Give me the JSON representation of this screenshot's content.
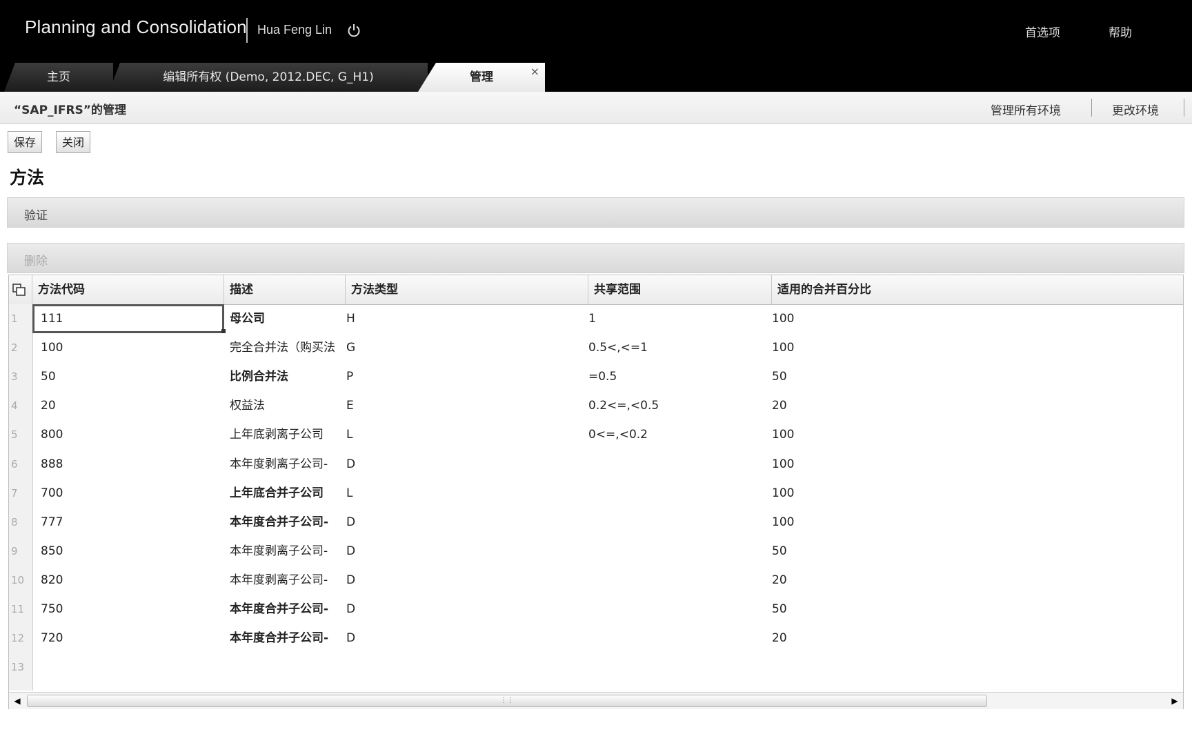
{
  "header": {
    "app_title": "Planning and Consolidation",
    "user": "Hua Feng Lin",
    "preferences": "首选项",
    "help": "帮助"
  },
  "tabs": [
    {
      "label": "主页"
    },
    {
      "label": "编辑所有权 (Demo, 2012.DEC, G_H1)"
    },
    {
      "label": "管理",
      "close": "×"
    }
  ],
  "subheader": {
    "title": "“SAP_IFRS”的管理",
    "manage_all_env": "管理所有环境",
    "change_env": "更改环境"
  },
  "toolbar": {
    "save": "保存",
    "close": "关闭"
  },
  "section_title": "方法",
  "validate": "验证",
  "delete": "删除",
  "grid": {
    "columns": [
      "方法代码",
      "描述",
      "方法类型",
      "共享范围",
      "适用的合并百分比"
    ],
    "rows": [
      {
        "num": "1",
        "code": "111",
        "desc": "母公司",
        "type": "H",
        "range": "1",
        "pct": "100"
      },
      {
        "num": "2",
        "code": "100",
        "desc": "完全合并法（购买法",
        "type": "G",
        "range": "0.5<,<=1",
        "pct": "100"
      },
      {
        "num": "3",
        "code": "50",
        "desc": "比例合并法",
        "type": "P",
        "range": "=0.5",
        "pct": "50"
      },
      {
        "num": "4",
        "code": "20",
        "desc": "权益法",
        "type": "E",
        "range": "0.2<=,<0.5",
        "pct": "20"
      },
      {
        "num": "5",
        "code": "800",
        "desc": "上年底剥离子公司",
        "type": "L",
        "range": "0<=,<0.2",
        "pct": "100"
      },
      {
        "num": "6",
        "code": "888",
        "desc": "本年度剥离子公司-",
        "type": "D",
        "range": "",
        "pct": "100"
      },
      {
        "num": "7",
        "code": "700",
        "desc": "上年底合并子公司",
        "type": "L",
        "range": "",
        "pct": "100"
      },
      {
        "num": "8",
        "code": "777",
        "desc": "本年度合并子公司-",
        "type": "D",
        "range": "",
        "pct": "100"
      },
      {
        "num": "9",
        "code": "850",
        "desc": "本年度剥离子公司-",
        "type": "D",
        "range": "",
        "pct": "50"
      },
      {
        "num": "10",
        "code": "820",
        "desc": "本年度剥离子公司-",
        "type": "D",
        "range": "",
        "pct": "20"
      },
      {
        "num": "11",
        "code": "750",
        "desc": "本年度合并子公司-",
        "type": "D",
        "range": "",
        "pct": "50"
      },
      {
        "num": "12",
        "code": "720",
        "desc": "本年度合并子公司-",
        "type": "D",
        "range": "",
        "pct": "20"
      },
      {
        "num": "13",
        "code": "",
        "desc": "",
        "type": "",
        "range": "",
        "pct": ""
      }
    ]
  }
}
